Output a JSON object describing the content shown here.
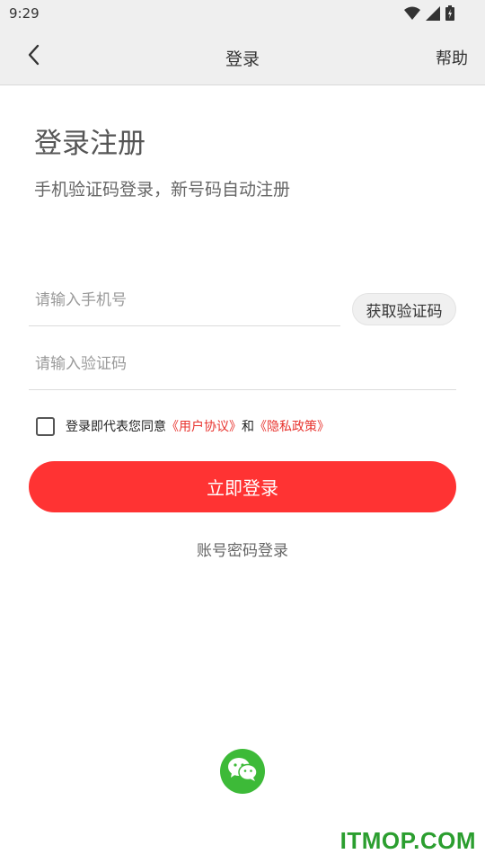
{
  "status_bar": {
    "time": "9:29",
    "icons": [
      "wifi-icon",
      "signal-icon",
      "battery-icon"
    ]
  },
  "nav": {
    "back_icon": "chevron-left-icon",
    "title": "登录",
    "help": "帮助"
  },
  "heading": "登录注册",
  "subtitle": "手机验证码登录，新号码自动注册",
  "form": {
    "phone_placeholder": "请输入手机号",
    "phone_value": "",
    "code_placeholder": "请输入验证码",
    "code_value": "",
    "get_code_label": "获取验证码"
  },
  "agreement": {
    "checked": false,
    "prefix": "登录即代表您同意",
    "user_agreement": "《用户协议》",
    "and": "和",
    "privacy_policy": "《隐私政策》"
  },
  "login_button": "立即登录",
  "password_login": "账号密码登录",
  "wechat_icon": "wechat-icon",
  "watermark": "ITMOP.COM",
  "colors": {
    "primary_red": "#ff3333",
    "link_red": "#e8342f",
    "wechat_green": "#3dba38",
    "watermark_green": "#2b9e2f",
    "bar_gray": "#efefef"
  }
}
